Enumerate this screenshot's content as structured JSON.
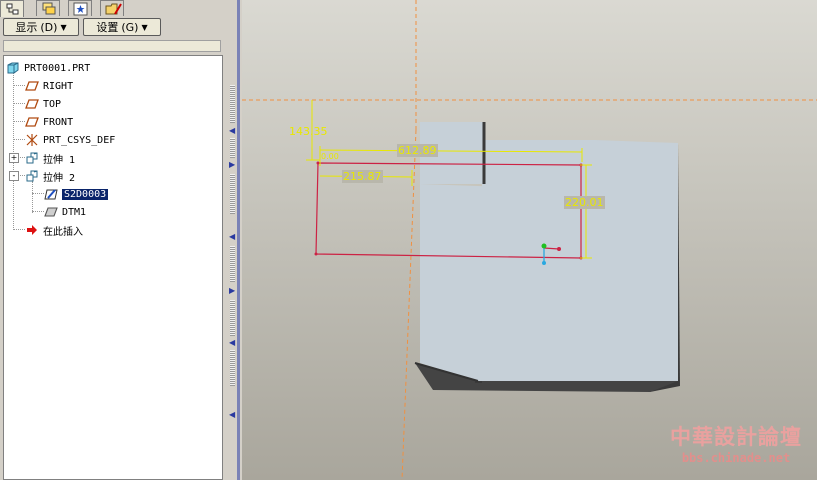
{
  "panel": {
    "tabs": [
      {
        "icon": "model-tree-icon",
        "active": true
      },
      {
        "icon": "layers-icon",
        "active": false
      },
      {
        "icon": "favorites-icon",
        "active": false
      },
      {
        "icon": "folder-browser-icon",
        "active": false
      }
    ],
    "show_menu_label": "显示",
    "show_menu_key": "(D)",
    "settings_menu_label": "设置",
    "settings_menu_key": "(G)"
  },
  "tree": {
    "root": "PRT0001.PRT",
    "items": [
      {
        "label": "RIGHT",
        "icon": "datum-plane-icon"
      },
      {
        "label": "TOP",
        "icon": "datum-plane-icon"
      },
      {
        "label": "FRONT",
        "icon": "datum-plane-icon"
      },
      {
        "label": "PRT_CSYS_DEF",
        "icon": "csys-icon"
      },
      {
        "label": "拉伸 1",
        "icon": "extrude-icon",
        "expander": "+"
      },
      {
        "label": "拉伸 2",
        "icon": "extrude-icon",
        "expander": "-"
      },
      {
        "label": "S2D0003",
        "icon": "sketch-icon",
        "selected": true
      },
      {
        "label": "DTM1",
        "icon": "datum-plane-icon"
      },
      {
        "label": "在此插入",
        "icon": "insert-here-arrow-icon"
      }
    ]
  },
  "dimensions": {
    "d1": "143.35",
    "d2": "612.89",
    "d3": "215.87",
    "d4": "220.01",
    "d5": "0.00"
  },
  "colors": {
    "datum_orange": "#f09040",
    "sketch_red": "#cc2244",
    "dimension_yellow": "#e8e800",
    "part_face": "#c6d0d8",
    "part_side": "#3a3a3a",
    "selection": "#0a246a"
  },
  "watermark": {
    "title": "中華設計論壇",
    "url": "bbs.chinade.net"
  }
}
